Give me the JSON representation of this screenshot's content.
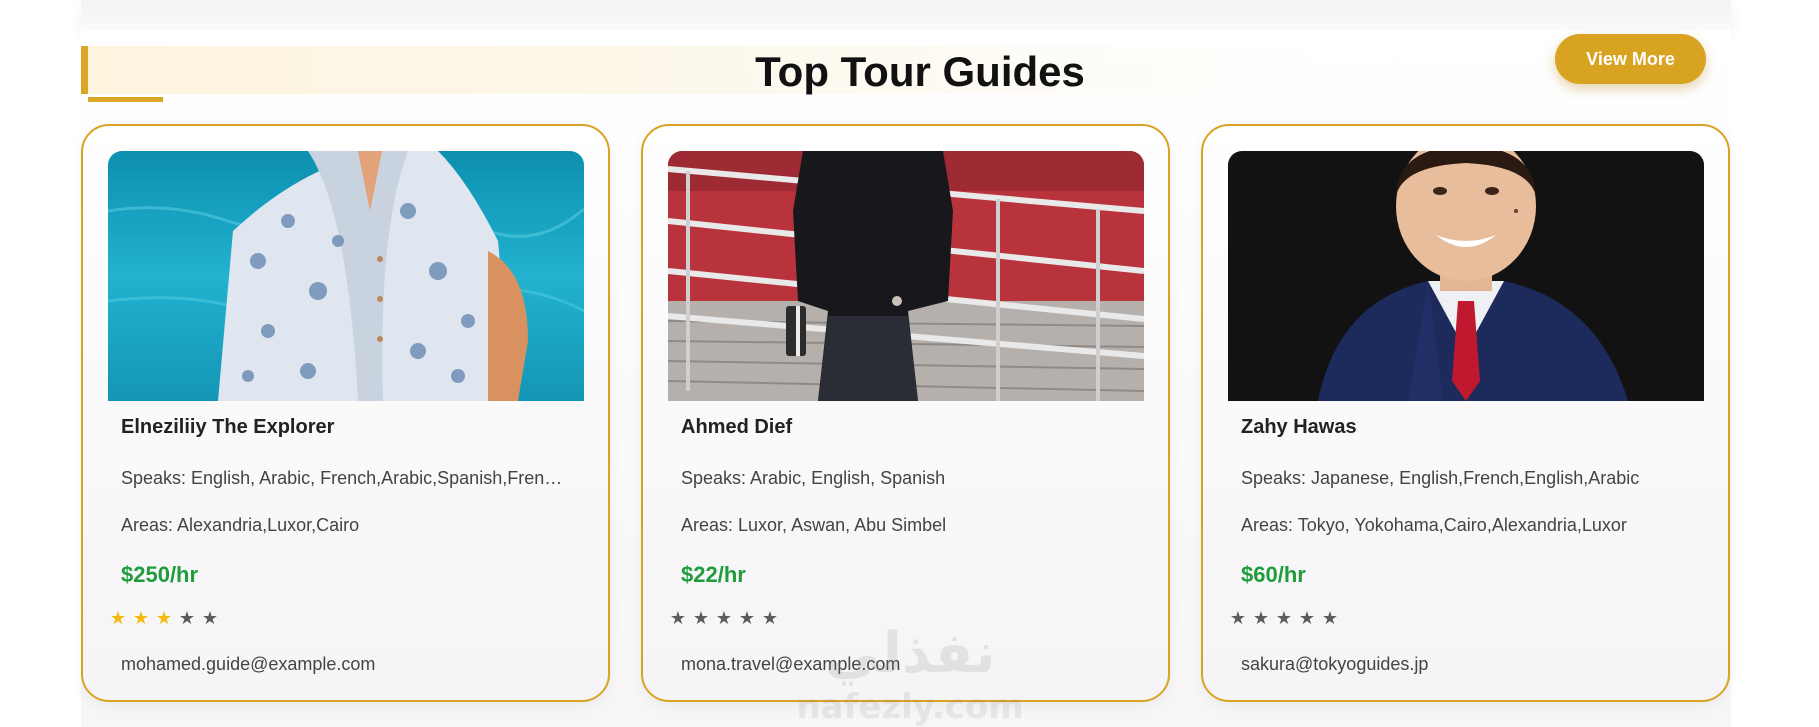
{
  "section": {
    "title": "Top Tour Guides",
    "view_more_label": "View More"
  },
  "guides": [
    {
      "name": "Elneziliiy The Explorer",
      "speaks": "Speaks: English, Arabic, French,Arabic,Spanish,French,German",
      "areas": "Areas: Alexandria,Luxor,Cairo",
      "price": "$250/hr",
      "rating": 3,
      "rating_max": 5,
      "email": "mohamed.guide@example.com"
    },
    {
      "name": "Ahmed Dief",
      "speaks": "Speaks: Arabic, English, Spanish",
      "areas": "Areas: Luxor, Aswan, Abu Simbel",
      "price": "$22/hr",
      "rating": 0,
      "rating_max": 5,
      "email": "mona.travel@example.com"
    },
    {
      "name": "Zahy Hawas",
      "speaks": "Speaks: Japanese, English,French,English,Arabic",
      "areas": "Areas: Tokyo, Yokohama,Cairo,Alexandria,Luxor",
      "price": "$60/hr",
      "rating": 0,
      "rating_max": 5,
      "email": "sakura@tokyoguides.jp"
    }
  ],
  "colors": {
    "accent": "#d9a322",
    "price": "#1f9c3b",
    "star_on": "#f3b90f",
    "star_off": "#5c5c5c"
  },
  "watermark": {
    "arabic": "نفذلي",
    "latin": "nafezly.com"
  }
}
